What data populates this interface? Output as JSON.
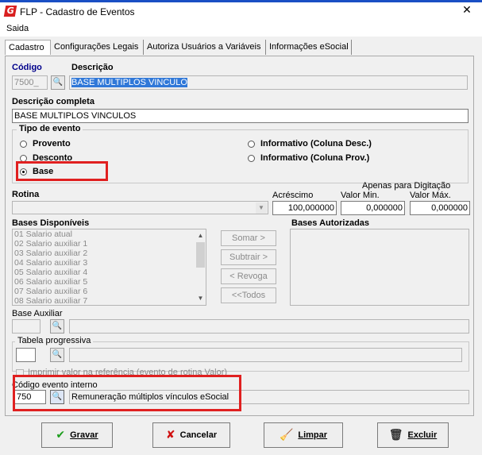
{
  "window": {
    "title": "FLP - Cadastro de Eventos",
    "close_symbol": "✕"
  },
  "menu": {
    "saida": "Saida"
  },
  "tabs": [
    {
      "label": "Cadastro"
    },
    {
      "label": "Configurações Legais"
    },
    {
      "label": "Autoriza Usuários a Variáveis"
    },
    {
      "label": "Informações eSocial"
    }
  ],
  "form": {
    "codigo_label": "Código",
    "codigo_value": "7500_",
    "descricao_label": "Descrição",
    "descricao_value": "BASE MULTIPLOS VINCULO",
    "descricao_completa_label": "Descrição completa",
    "descricao_completa_value": "BASE MULTIPLOS VINCULOS",
    "tipo_evento_label": "Tipo de evento",
    "tipo_options": [
      {
        "label": "Provento",
        "selected": false
      },
      {
        "label": "Desconto",
        "selected": false
      },
      {
        "label": "Base",
        "selected": true
      },
      {
        "label": "Informativo (Coluna Desc.)",
        "selected": false
      },
      {
        "label": "Informativo (Coluna Prov.)",
        "selected": false
      }
    ],
    "rotina_label": "Rotina",
    "apenas_label": "Apenas para Digitação",
    "acrescimo_label": "Acréscimo",
    "acrescimo_value": "100,000000",
    "valor_min_label": "Valor Min.",
    "valor_min_value": "0,000000",
    "valor_max_label": "Valor Máx.",
    "valor_max_value": "0,000000",
    "bases_disponiveis_label": "Bases Disponíveis",
    "bases_disponiveis": [
      "01 Salario atual",
      "02 Salario auxiliar 1",
      "03 Salario auxiliar 2",
      "04 Salario auxiliar 3",
      "05 Salario auxiliar 4",
      "06 Salario auxiliar 5",
      "07 Salario auxiliar 6",
      "08 Salario auxiliar 7"
    ],
    "bases_autorizadas_label": "Bases Autorizadas",
    "somar_label": "Somar >",
    "subtrair_label": "Subtrair >",
    "revoga_label": "< Revoga",
    "todos_label": "<<Todos",
    "base_auxiliar_label": "Base Auxiliar",
    "tabela_progressiva_label": "Tabela progressiva",
    "imprimir_label": "Imprimir valor na referência (evento de rotina Valor)",
    "codigo_interno_label": "Código evento interno",
    "codigo_interno_value": "750",
    "codigo_interno_desc": "Remuneração múltiplos vínculos eSocial"
  },
  "buttons": {
    "gravar": "Gravar",
    "cancelar": "Cancelar",
    "limpar": "Limpar",
    "excluir": "Excluir"
  },
  "colors": {
    "accent": "#1a4fc4",
    "highlight": "#e02020",
    "selection": "#3078d8"
  }
}
